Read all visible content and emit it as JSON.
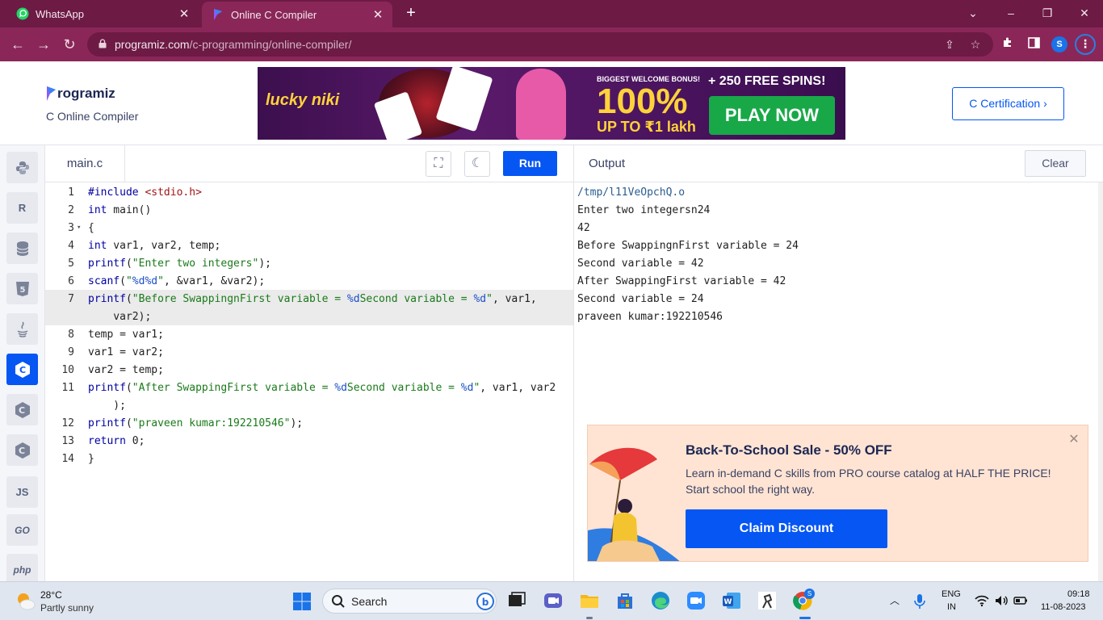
{
  "browser": {
    "tabs": [
      {
        "title": "WhatsApp",
        "icon": "whatsapp-icon"
      },
      {
        "title": "Online C Compiler",
        "icon": "programiz-icon"
      }
    ],
    "url_host": "programiz.com",
    "url_path": "/c-programming/online-compiler/",
    "profile_initial": "S",
    "colors": {
      "frame": "#6d1a45",
      "toolbar": "#8a2758"
    }
  },
  "header": {
    "logo_text": "rogramiz",
    "subtitle": "C Online Compiler",
    "banner": {
      "brand": "lucky niki",
      "bonus_line": "BIGGEST WELCOME BONUS!",
      "percent": "100%",
      "upto": "UP TO ₹1 lakh",
      "spins": "+ 250 FREE SPINS!",
      "cta": "PLAY NOW"
    },
    "cert_button": "C Certification ›"
  },
  "sidebar": {
    "items": [
      {
        "name": "python",
        "label": "",
        "icon": "python-icon"
      },
      {
        "name": "r",
        "label": "R",
        "icon": "r-icon"
      },
      {
        "name": "sql",
        "label": "",
        "icon": "database-icon"
      },
      {
        "name": "html",
        "label": "5",
        "icon": "html5-icon"
      },
      {
        "name": "java",
        "label": "",
        "icon": "java-icon"
      },
      {
        "name": "c",
        "label": "C",
        "icon": "c-icon"
      },
      {
        "name": "cpp",
        "label": "C",
        "icon": "cpp-icon"
      },
      {
        "name": "csharp",
        "label": "C",
        "icon": "csharp-icon"
      },
      {
        "name": "js",
        "label": "JS",
        "icon": "js-icon"
      },
      {
        "name": "go",
        "label": "GO",
        "icon": "go-icon"
      },
      {
        "name": "php",
        "label": "php",
        "icon": "php-icon"
      }
    ]
  },
  "editor": {
    "filename": "main.c",
    "run_label": "Run",
    "lines": [
      {
        "n": "1",
        "text": "#include <stdio.h>"
      },
      {
        "n": "2",
        "text": "int main()"
      },
      {
        "n": "3",
        "text": "{"
      },
      {
        "n": "4",
        "text": "int var1, var2, temp;"
      },
      {
        "n": "5",
        "text": "printf(\"Enter two integers\");"
      },
      {
        "n": "6",
        "text": "scanf(\"%d%d\", &var1, &var2);"
      },
      {
        "n": "7",
        "text": "printf(\"Before SwappingnFirst variable = %dSecond variable = %d\", var1,"
      },
      {
        "n": "",
        "text": "    var2);"
      },
      {
        "n": "8",
        "text": "temp = var1;"
      },
      {
        "n": "9",
        "text": "var1 = var2;"
      },
      {
        "n": "10",
        "text": "var2 = temp;"
      },
      {
        "n": "11",
        "text": "printf(\"After SwappingFirst variable = %dSecond variable = %d\", var1, var2"
      },
      {
        "n": "",
        "text": "    );"
      },
      {
        "n": "12",
        "text": "printf(\"praveen kumar:192210546\");"
      },
      {
        "n": "13",
        "text": "return 0;"
      },
      {
        "n": "14",
        "text": "}"
      }
    ]
  },
  "output": {
    "title": "Output",
    "clear_label": "Clear",
    "lines": [
      "/tmp/l11VeOpchQ.o",
      "Enter two integersn24",
      "42",
      "Before SwappingnFirst variable = 24",
      "Second variable = 42",
      "After SwappingFirst variable = 42",
      "Second variable = 24",
      "praveen kumar:192210546"
    ]
  },
  "promo": {
    "title": "Back-To-School Sale - 50% OFF",
    "description": "Learn in-demand C skills from PRO course catalog at HALF THE PRICE! Start school the right way.",
    "button": "Claim Discount"
  },
  "taskbar": {
    "temperature": "28°C",
    "condition": "Partly sunny",
    "search_label": "Search",
    "lang_top": "ENG",
    "lang_bottom": "IN",
    "time": "09:18",
    "date": "11-08-2023",
    "apps": [
      "file-explorer-icon",
      "meet-icon",
      "folder-icon",
      "store-icon",
      "edge-icon",
      "zoom-icon",
      "word-icon",
      "game-icon",
      "chrome-icon"
    ]
  }
}
